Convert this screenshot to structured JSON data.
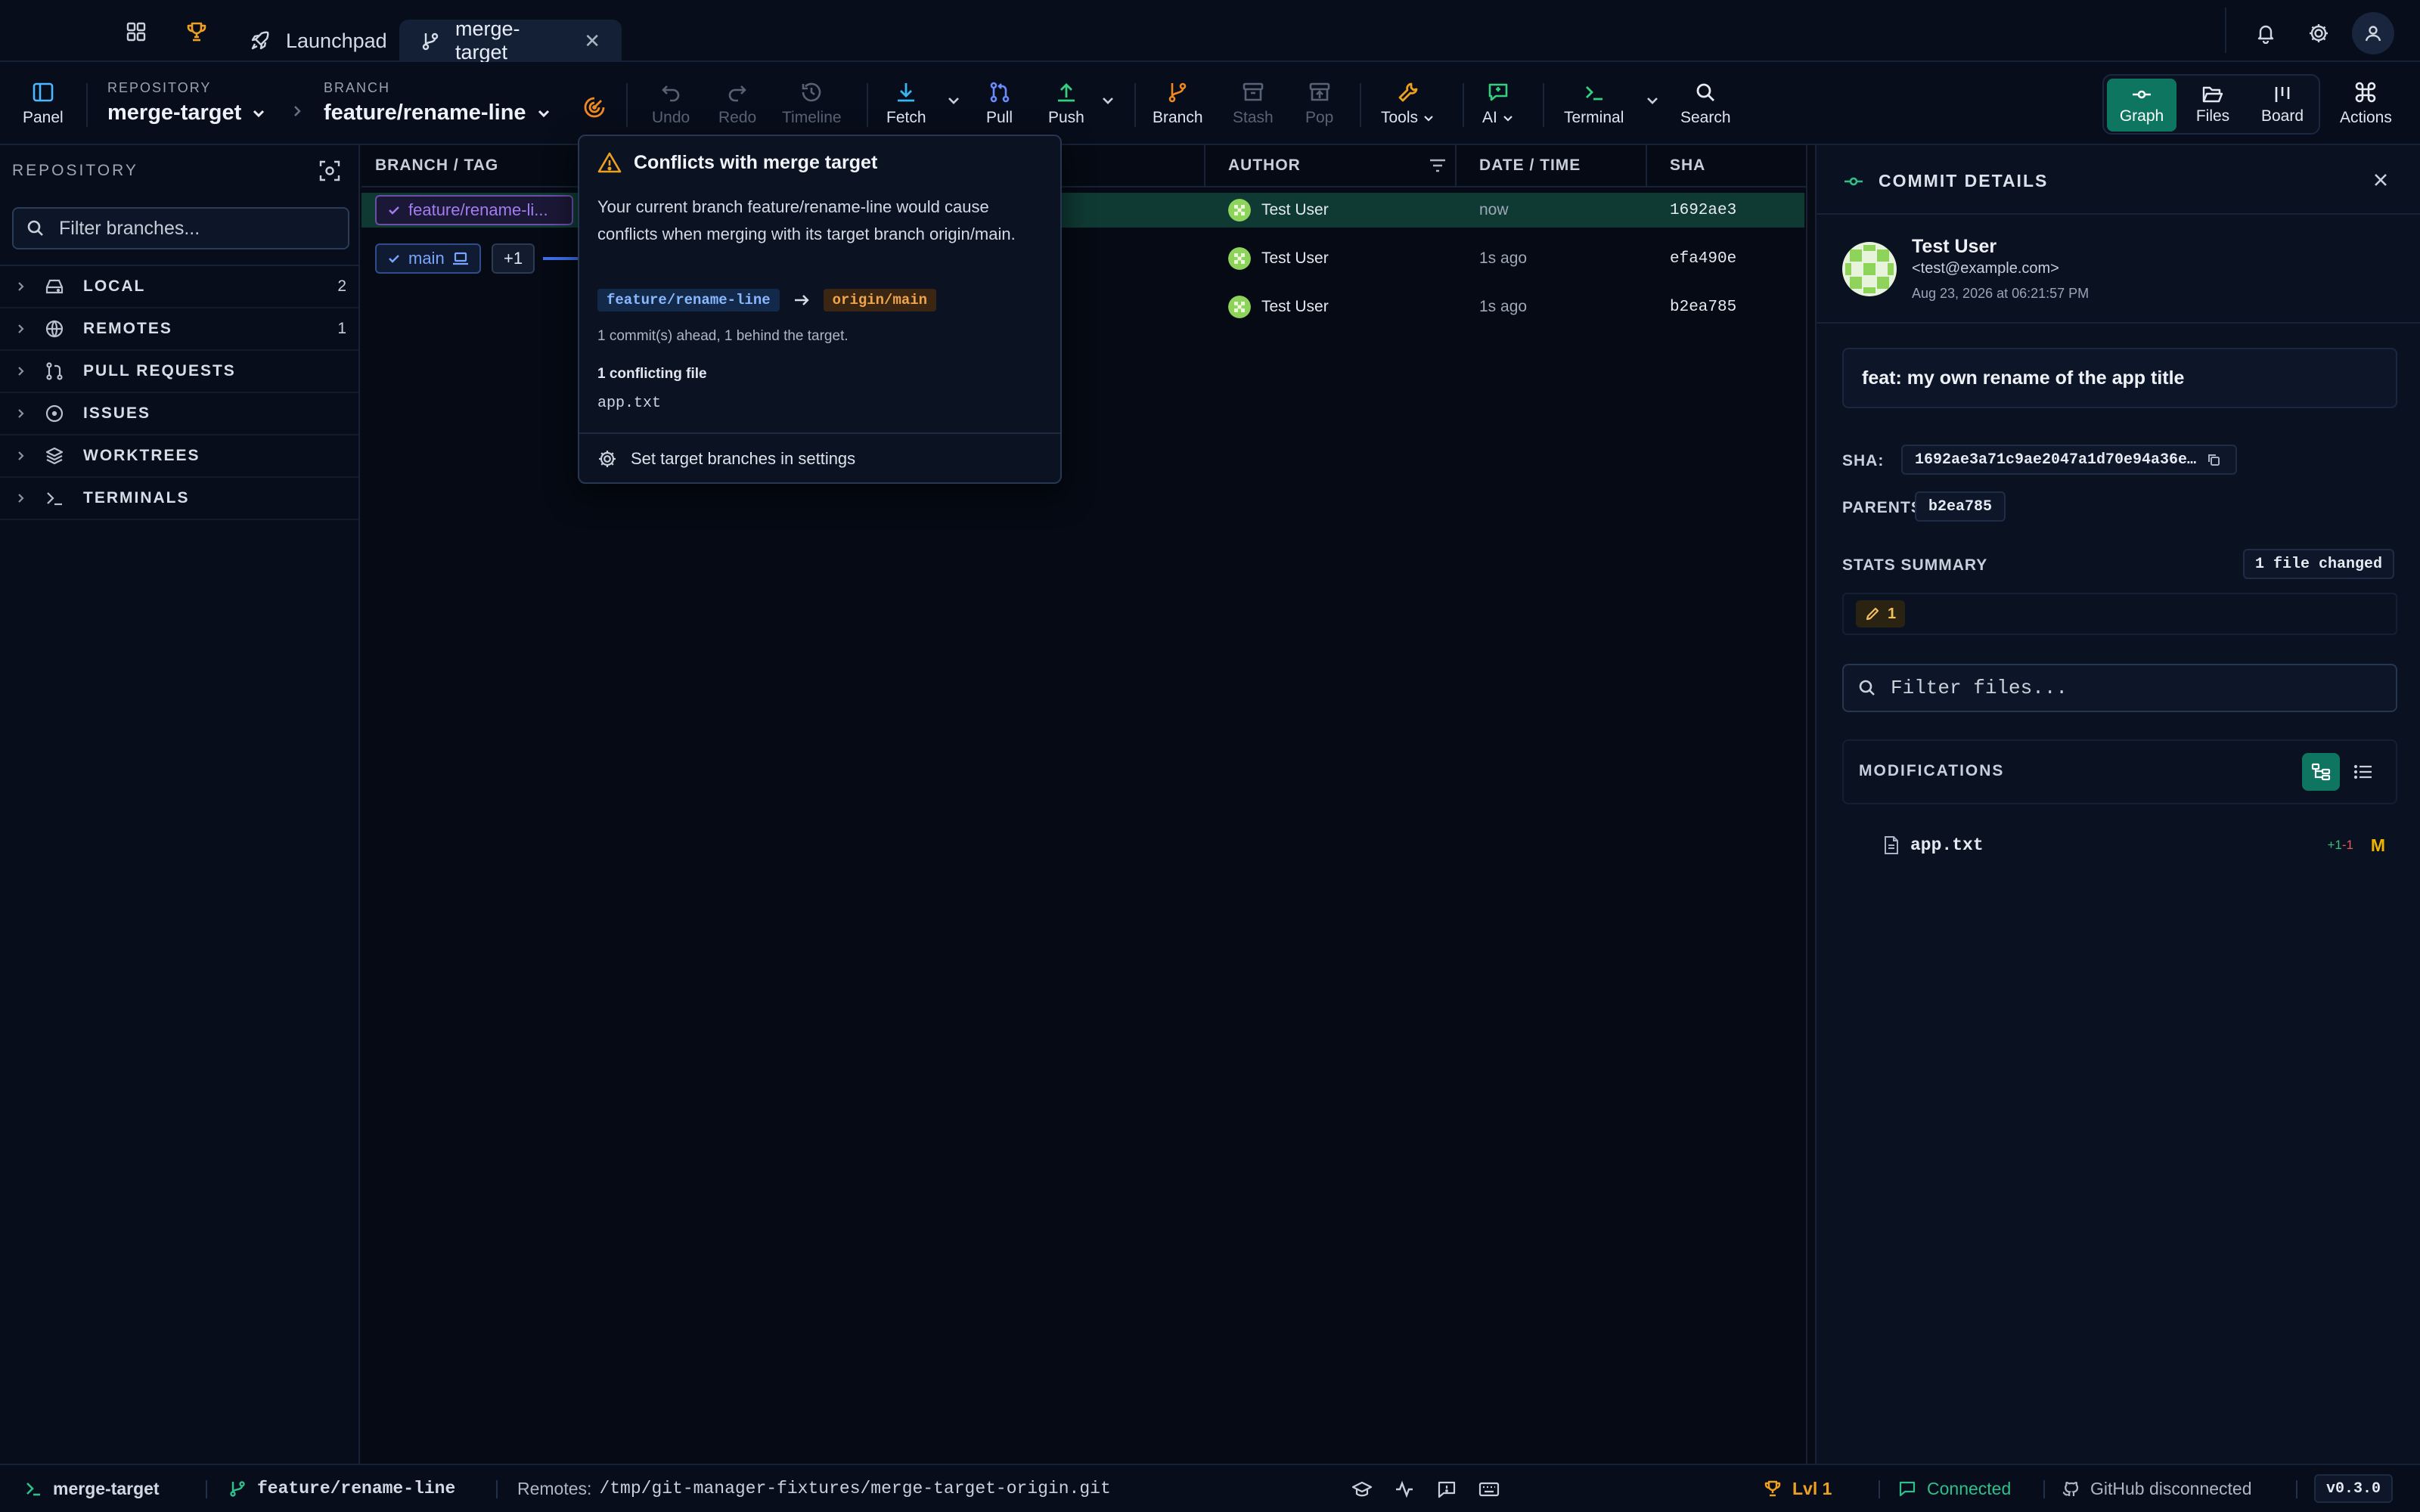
{
  "colors": {
    "accent_green": "#0d7560",
    "branch_purple": "#a27cf0",
    "branch_blue": "#7aa5ff",
    "warning_orange": "#f0a54a",
    "modified_yellow": "#f0b400",
    "connected_green": "#2fbf8a"
  },
  "tabs": [
    {
      "label": "Launchpad",
      "icon": "rocket-icon"
    },
    {
      "label": "merge-target",
      "icon": "branch-icon",
      "active": true
    }
  ],
  "toolbar": {
    "panel_label": "Panel",
    "repo_label": "REPOSITORY",
    "repo_value": "merge-target",
    "branch_label": "BRANCH",
    "branch_value": "feature/rename-line",
    "undo": "Undo",
    "redo": "Redo",
    "timeline": "Timeline",
    "fetch": "Fetch",
    "pull": "Pull",
    "push": "Push",
    "branch": "Branch",
    "stash": "Stash",
    "pop": "Pop",
    "tools": "Tools",
    "ai": "AI",
    "terminal": "Terminal",
    "search": "Search",
    "views": [
      "Graph",
      "Files",
      "Board"
    ],
    "actions": "Actions"
  },
  "sidebar": {
    "title": "REPOSITORY",
    "filter_placeholder": "Filter branches...",
    "items": [
      {
        "label": "LOCAL",
        "count": "2",
        "icon": "drive-icon"
      },
      {
        "label": "REMOTES",
        "count": "1",
        "icon": "globe-icon"
      },
      {
        "label": "PULL REQUESTS",
        "count": "",
        "icon": "pull-request-icon"
      },
      {
        "label": "ISSUES",
        "count": "",
        "icon": "issue-icon"
      },
      {
        "label": "WORKTREES",
        "count": "",
        "icon": "layers-icon"
      },
      {
        "label": "TERMINALS",
        "count": "",
        "icon": "terminal-icon"
      }
    ]
  },
  "graph": {
    "columns": {
      "branch": "BRANCH / TAG",
      "author": "AUTHOR",
      "date": "DATE / TIME",
      "sha": "SHA"
    },
    "branch_tags": {
      "current": "feature/rename-li...",
      "main": "main",
      "plus": "+1"
    },
    "rows": [
      {
        "author": "Test User",
        "date": "now",
        "sha": "1692ae3",
        "selected": true
      },
      {
        "author": "Test User",
        "date": "1s ago",
        "sha": "efa490e",
        "selected": false
      },
      {
        "author": "Test User",
        "date": "1s ago",
        "sha": "b2ea785",
        "selected": false
      }
    ]
  },
  "popover": {
    "title": "Conflicts with merge target",
    "message": "Your current branch feature/rename-line would cause conflicts when merging with its target branch origin/main.",
    "source": "feature/rename-line",
    "target": "origin/main",
    "ahead_behind": "1 commit(s) ahead, 1 behind the target.",
    "conflict_title": "1 conflicting file",
    "conflict_file": "app.txt",
    "settings_link": "Set target branches in settings"
  },
  "details": {
    "title": "COMMIT DETAILS",
    "author_name": "Test User",
    "author_email": "<test@example.com>",
    "date": "Aug 23, 2026 at 06:21:57 PM",
    "message": "feat: my own rename of the app title",
    "sha_label": "SHA:",
    "sha_value": "1692ae3a71c9ae2047a1d70e94a36e…",
    "parents_label": "PARENTS:",
    "parent_value": "b2ea785",
    "stats_label": "STATS SUMMARY",
    "files_changed": "1 file changed",
    "modified_count": "1",
    "filter_placeholder": "Filter files...",
    "modifications_label": "MODIFICATIONS",
    "files": [
      {
        "name": "app.txt",
        "added": "+1",
        "removed": "-1",
        "status": "M"
      }
    ]
  },
  "statusbar": {
    "repo": "merge-target",
    "branch": "feature/rename-line",
    "remotes_label": "Remotes:",
    "remotes_path": "/tmp/git-manager-fixtures/merge-target-origin.git",
    "level": "Lvl 1",
    "connection": "Connected",
    "github": "GitHub disconnected",
    "version": "v0.3.0"
  }
}
